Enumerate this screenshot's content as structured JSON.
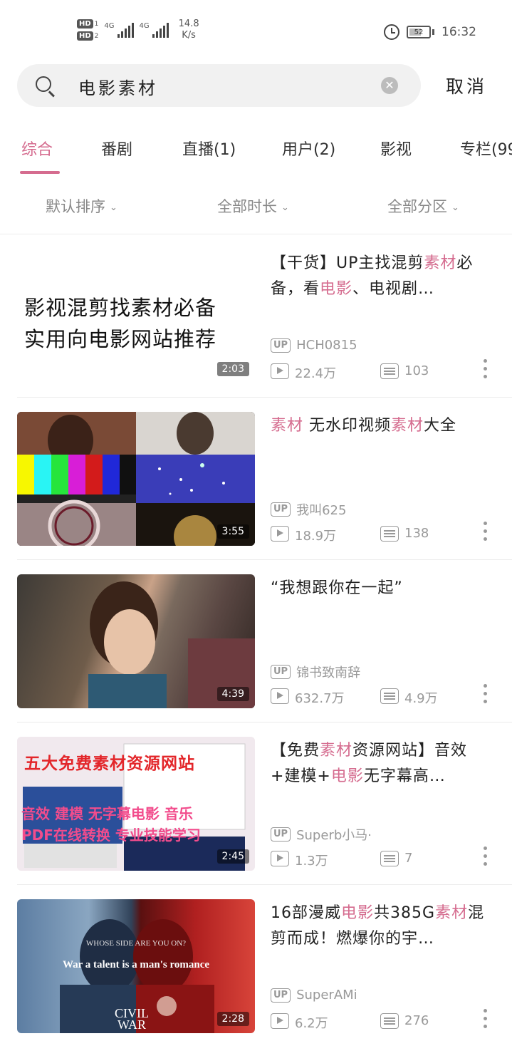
{
  "status_bar": {
    "hd1": "HD",
    "hd1_num": "1",
    "hd2": "HD",
    "hd2_num": "2",
    "signal1": "4G",
    "signal2": "4G",
    "speed_value": "14.8",
    "speed_unit": "K/s",
    "battery": "52",
    "time": "16:32"
  },
  "search": {
    "query": "电影素材",
    "cancel_label": "取消"
  },
  "tabs": [
    "综合",
    "番剧",
    "直播(1)",
    "用户(2)",
    "影视",
    "专栏(99"
  ],
  "active_tab": 0,
  "filters": [
    "默认排序",
    "全部时长",
    "全部分区"
  ],
  "results": [
    {
      "title_parts": [
        {
          "text": "【干货】UP主找混剪",
          "hl": false
        },
        {
          "text": "素材",
          "hl": true
        },
        {
          "text": "必备，看",
          "hl": false
        },
        {
          "text": "电影",
          "hl": true
        },
        {
          "text": "、电视剧…",
          "hl": false
        }
      ],
      "thumb_caption": "影视混剪找素材必备\n实用向电影网站推荐",
      "duration": "2:03",
      "up_badge": "UP",
      "uploader": "HCH0815",
      "views": "22.4万",
      "danmaku": "103"
    },
    {
      "title_parts": [
        {
          "text": "素材",
          "hl": true
        },
        {
          "text": " 无水印视频",
          "hl": false
        },
        {
          "text": "素材",
          "hl": true
        },
        {
          "text": "大全",
          "hl": false
        }
      ],
      "thumb_caption": "",
      "duration": "3:55",
      "up_badge": "UP",
      "uploader": "我叫625",
      "views": "18.9万",
      "danmaku": "138"
    },
    {
      "title_parts": [
        {
          "text": "“我想跟你在一起”",
          "hl": false
        }
      ],
      "thumb_caption": "",
      "duration": "4:39",
      "up_badge": "UP",
      "uploader": "锦书致南辞",
      "views": "632.7万",
      "danmaku": "4.9万"
    },
    {
      "title_parts": [
        {
          "text": "【免费",
          "hl": false
        },
        {
          "text": "素材",
          "hl": true
        },
        {
          "text": "资源网站】音效+建模+",
          "hl": false
        },
        {
          "text": "电影",
          "hl": true
        },
        {
          "text": "无字幕高…",
          "hl": false
        }
      ],
      "thumb_caption": "五大免费素材资源网站",
      "thumb_caption2": "音效 建模 无字幕电影 音乐",
      "thumb_caption3": "PDF在线转换 专业技能学习",
      "duration": "2:45",
      "up_badge": "UP",
      "uploader": "Superb小马·",
      "views": "1.3万",
      "danmaku": "7"
    },
    {
      "title_parts": [
        {
          "text": "16部漫威",
          "hl": false
        },
        {
          "text": "电影",
          "hl": true
        },
        {
          "text": "共385G",
          "hl": false
        },
        {
          "text": "素材",
          "hl": true
        },
        {
          "text": "混剪而成！燃爆你的宇…",
          "hl": false
        }
      ],
      "thumb_caption": "WHOSE SIDE ARE YOU ON?",
      "thumb_caption2": "War a talent is a man's romance",
      "thumb_caption3": "CIVIL WAR",
      "duration": "2:28",
      "up_badge": "UP",
      "uploader": "SuperAMi",
      "views": "6.2万",
      "danmaku": "276"
    }
  ],
  "colors": {
    "accent": "#d56c8f",
    "meta": "#999999"
  }
}
